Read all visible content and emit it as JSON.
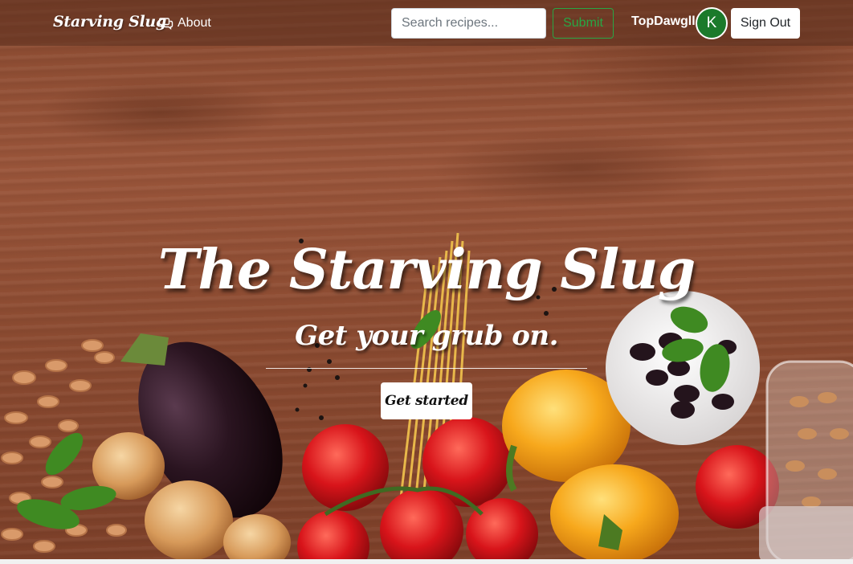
{
  "navbar": {
    "brand": "Starving Slug",
    "about_label": "About",
    "about_icon": "chat-bubbles-icon",
    "search": {
      "placeholder": "Search recipes...",
      "value": ""
    },
    "submit_label": "Submit",
    "username": "TopDawgll",
    "avatar_initial": "K",
    "signout_label": "Sign Out"
  },
  "hero": {
    "title": "The Starving Slug",
    "subtitle": "Get your grub on.",
    "cta_label": "Get started"
  },
  "colors": {
    "submit_outline": "#28a745",
    "avatar_bg": "#1b7a2b",
    "wood": "#8a4a30"
  }
}
